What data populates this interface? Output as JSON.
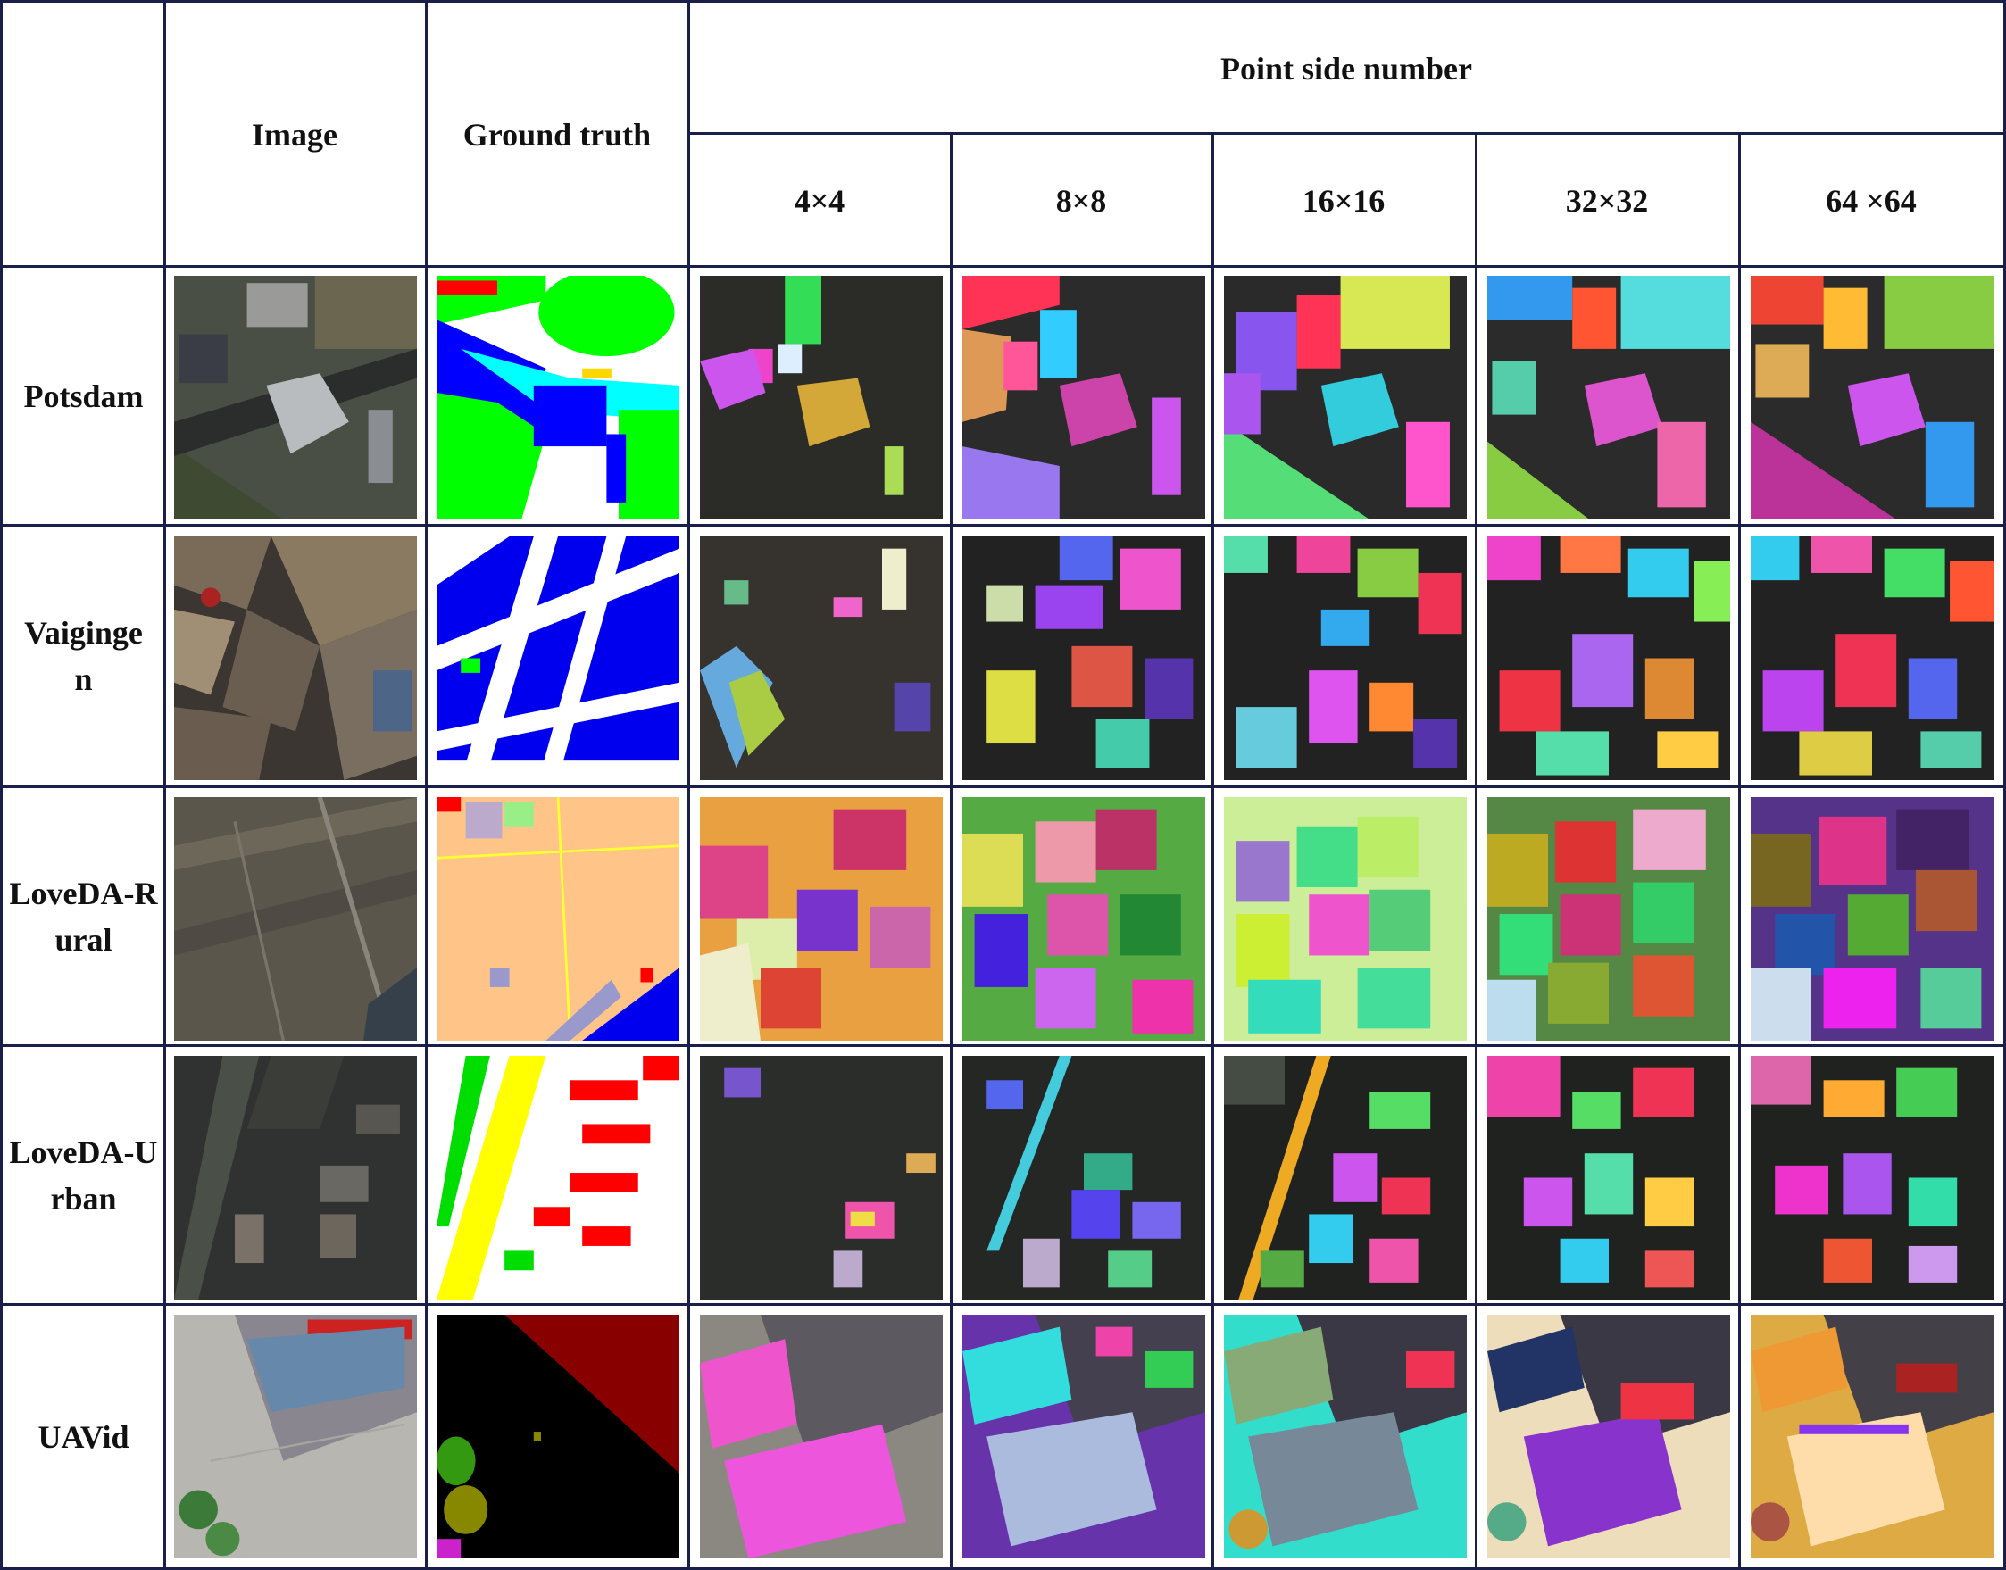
{
  "header": {
    "image": "Image",
    "ground_truth": "Ground truth",
    "point_side_number": "Point side number",
    "sizes": [
      "4×4",
      "8×8",
      "16×16",
      "32×32",
      "64 ×64"
    ]
  },
  "rows": [
    {
      "label": "Potsdam"
    },
    {
      "label": "Vaiginge n"
    },
    {
      "label": "LoveDA-Rural"
    },
    {
      "label": "LoveDA-Urban"
    },
    {
      "label": "UAVid"
    }
  ]
}
